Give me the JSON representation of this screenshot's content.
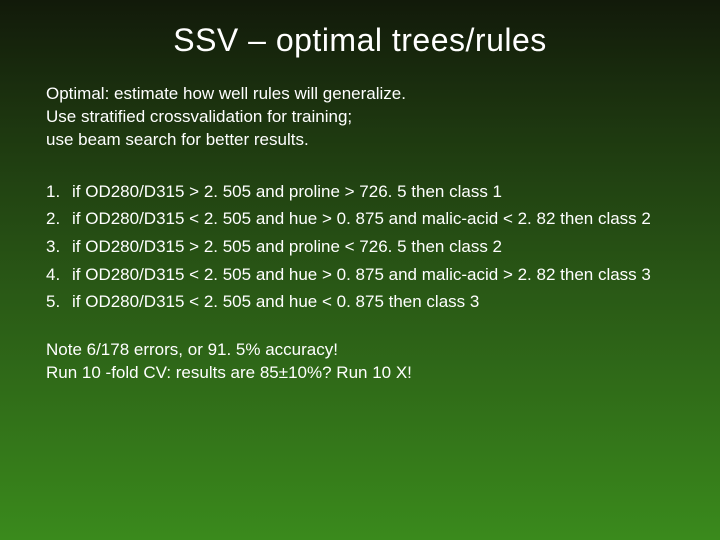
{
  "title": "SSV – optimal trees/rules",
  "intro": {
    "line1": "Optimal: estimate how well rules will generalize.",
    "line2": "Use stratified crossvalidation for training;",
    "line3": "use beam search for better results."
  },
  "rules": [
    {
      "n": "1.",
      "text": "if OD280/D315 > 2. 505 and proline > 726. 5 then class 1"
    },
    {
      "n": "2.",
      "text": "if OD280/D315 < 2. 505 and hue > 0. 875 and malic-acid < 2. 82 then class 2"
    },
    {
      "n": "3.",
      "text": "if OD280/D315 > 2. 505 and proline < 726. 5 then class 2"
    },
    {
      "n": "4.",
      "text": "if OD280/D315 < 2. 505 and hue > 0. 875 and malic-acid > 2. 82 then class 3"
    },
    {
      "n": "5.",
      "text": "if OD280/D315 < 2. 505 and hue < 0. 875 then class 3"
    }
  ],
  "note": {
    "line1": "Note 6/178 errors, or 91. 5% accuracy!",
    "line2": "Run 10 -fold CV: results are 85±10%? Run 10 X!"
  }
}
